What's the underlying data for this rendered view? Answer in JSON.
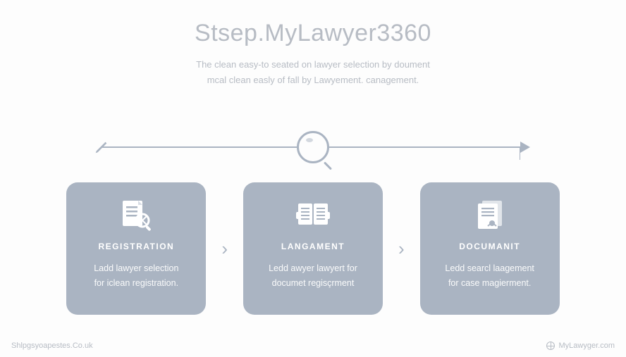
{
  "header": {
    "title": "Stsep.MyLawyer3360",
    "subtitle_line1": "The clean easy-to seated on lawyer selection by doument",
    "subtitle_line2": "mcal clean easly of fall by Lawyement. canagement."
  },
  "timeline": {
    "start_icon": "pencil-icon",
    "center_icon": "magnifier-icon",
    "end_icon": "arrowhead-icon"
  },
  "cards": [
    {
      "icon": "doc-search-icon",
      "title": "REGISTRATION",
      "desc_line1": "Ladd lawyer selection",
      "desc_line2": "for iclean registration."
    },
    {
      "icon": "open-book-icon",
      "title": "LANGAMENT",
      "desc_line1": "Ledd awyer lawyert for",
      "desc_line2": "documet regisçrment"
    },
    {
      "icon": "doc-stamp-icon",
      "title": "DOCUMANIT",
      "desc_line1": "Ledd searcl laagement",
      "desc_line2": "for case magierment."
    }
  ],
  "chevron": "›",
  "footer": {
    "left": "Shlpgsyoapestes.Co.uk",
    "right": "MyLawyger.com"
  }
}
